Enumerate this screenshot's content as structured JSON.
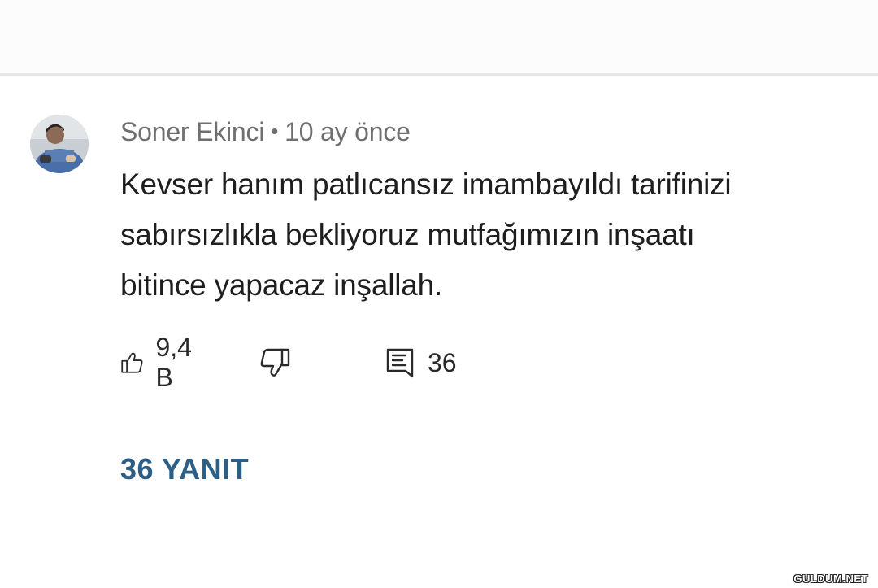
{
  "comment": {
    "author": "Soner Ekinci",
    "separator": "•",
    "time": "10 ay önce",
    "text_lines": [
      "Kevser hanım patlıcansız imambayıldı tarifinizi",
      "sabırsızlıkla bekliyoruz mutfağımızın inşaatı",
      "bitince yapacaz inşallah."
    ],
    "like_count": "9,4 B",
    "reply_count": "36",
    "replies_link": "36 YANIT"
  },
  "icons": {
    "like": "thumbs-up-icon",
    "dislike": "thumbs-down-icon",
    "reply": "comment-icon"
  },
  "colors": {
    "replies_link": "#2d5f86",
    "meta_text": "#6f6f6f",
    "comment_text": "#1e1e1e"
  },
  "watermark": "GULDUM.NET"
}
